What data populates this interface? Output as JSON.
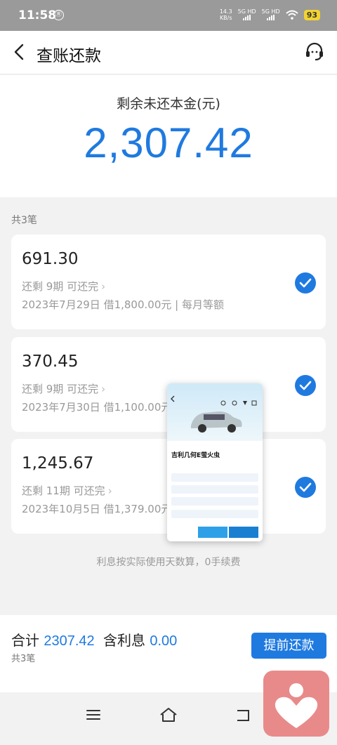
{
  "status_bar": {
    "time": "11:58",
    "app_badge": "Ⓡ",
    "net_speed_value": "14.3",
    "net_speed_unit": "KB/s",
    "sim1_label": "5G HD",
    "sim2_label": "5G HD",
    "battery": "93"
  },
  "nav": {
    "title": "查账还款",
    "back_icon": "back-arrow-icon",
    "service_icon": "customer-service-icon"
  },
  "summary": {
    "label": "剩余未还本金(元)",
    "amount": "2,307.42"
  },
  "list": {
    "count_label": "共3笔",
    "loans": [
      {
        "amount": "691.30",
        "remaining": "还剩 9期 可还完",
        "detail": "2023年7月29日 借1,800.00元 | 每月等额",
        "checked": true
      },
      {
        "amount": "370.45",
        "remaining": "还剩 9期 可还完",
        "detail": "2023年7月30日 借1,100.00元",
        "checked": true
      },
      {
        "amount": "1,245.67",
        "remaining": "还剩 11期 可还完",
        "detail": "2023年10月5日 借1,379.00元",
        "checked": true
      }
    ]
  },
  "note": "利息按实际使用天数算，0手续费",
  "bottom": {
    "total_label": "合计",
    "total_value": "2307.42",
    "interest_label": "含利息",
    "interest_value": "0.00",
    "count": "共3笔",
    "prepay_button": "提前还款"
  },
  "popup": {
    "car_title": "吉利几何E萤火虫"
  },
  "colors": {
    "accent": "#1f7ae0",
    "status_bar": "#9a9a9a",
    "float_button": "#e98a8a"
  }
}
